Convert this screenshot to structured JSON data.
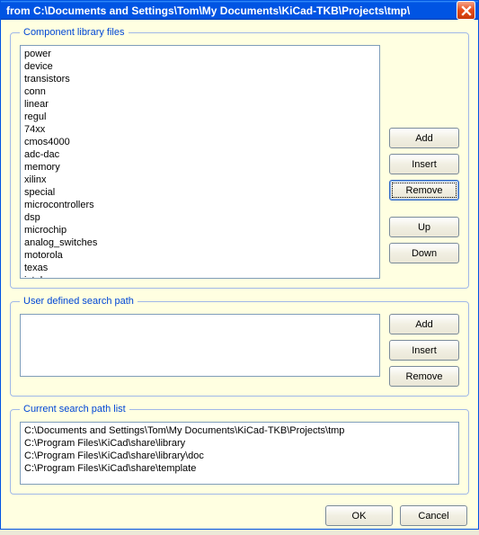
{
  "window": {
    "title": "from C:\\Documents and Settings\\Tom\\My Documents\\KiCad-TKB\\Projects\\tmp\\"
  },
  "groups": {
    "libraries": {
      "legend": "Component library files",
      "buttons": {
        "add": "Add",
        "insert": "Insert",
        "remove": "Remove",
        "up": "Up",
        "down": "Down"
      },
      "items": [
        "power",
        "device",
        "transistors",
        "conn",
        "linear",
        "regul",
        "74xx",
        "cmos4000",
        "adc-dac",
        "memory",
        "xilinx",
        "special",
        "microcontrollers",
        "dsp",
        "microchip",
        "analog_switches",
        "motorola",
        "texas",
        "intel"
      ]
    },
    "userpath": {
      "legend": "User defined search path",
      "buttons": {
        "add": "Add",
        "insert": "Insert",
        "remove": "Remove"
      },
      "items": []
    },
    "searchpath": {
      "legend": "Current search path list",
      "items": [
        "C:\\Documents and Settings\\Tom\\My Documents\\KiCad-TKB\\Projects\\tmp",
        "C:\\Program Files\\KiCad\\share\\library",
        "C:\\Program Files\\KiCad\\share\\library\\doc",
        "C:\\Program Files\\KiCad\\share\\template"
      ]
    }
  },
  "footer": {
    "ok": "OK",
    "cancel": "Cancel"
  }
}
